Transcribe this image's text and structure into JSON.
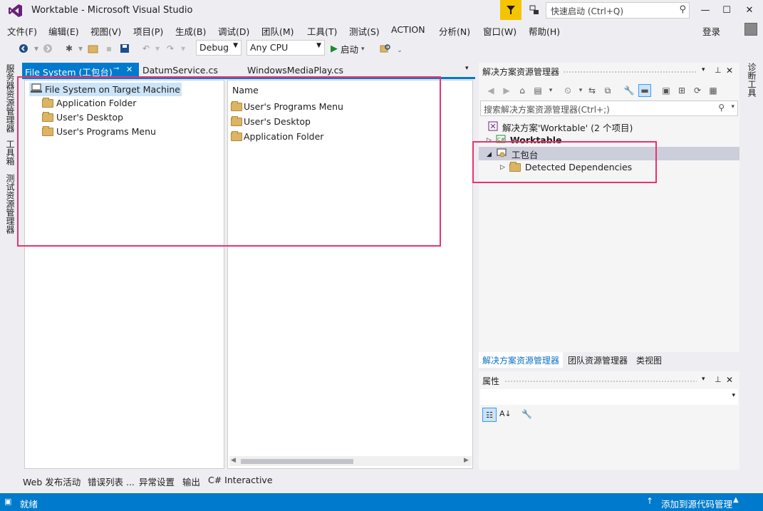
{
  "window": {
    "title": "Worktable - Microsoft Visual Studio"
  },
  "quick_launch": {
    "placeholder": "快速启动 (Ctrl+Q)"
  },
  "menu": [
    "文件(F)",
    "编辑(E)",
    "视图(V)",
    "项目(P)",
    "生成(B)",
    "调试(D)",
    "团队(M)",
    "工具(T)",
    "测试(S)",
    "ACTION",
    "分析(N)",
    "窗口(W)",
    "帮助(H)"
  ],
  "account": {
    "login": "登录"
  },
  "toolbar": {
    "config": "Debug",
    "platform": "Any CPU",
    "start": "启动"
  },
  "left_side_tabs": [
    "服务器资源管理器",
    "工具箱",
    "测试资源管理器"
  ],
  "right_side_tabs": [
    "诊断工具"
  ],
  "doc_tabs": [
    {
      "label": "File System (工包台)",
      "active": true,
      "pin": "⊸",
      "close": "✕"
    },
    {
      "label": "DatumService.cs"
    },
    {
      "label": "WindowsMediaPlay.cs"
    }
  ],
  "fs_tree": {
    "root": "File System on Target Machine",
    "children": [
      "Application Folder",
      "User's Desktop",
      "User's Programs Menu"
    ]
  },
  "fs_list": {
    "header": "Name",
    "items": [
      "User's Programs Menu",
      "User's Desktop",
      "Application Folder"
    ]
  },
  "solution_explorer": {
    "title": "解决方案资源管理器",
    "search_placeholder": "搜索解决方案资源管理器(Ctrl+;)",
    "solution": "解决方案'Worktable' (2 个项目)",
    "project1": "Worktable",
    "project2": "工包台",
    "child": "Detected Dependencies"
  },
  "bottom_tabs": [
    "解决方案资源管理器",
    "团队资源管理器",
    "类视图"
  ],
  "properties": {
    "title": "属性"
  },
  "output_tabs": [
    "Web 发布活动",
    "错误列表 ...",
    "异常设置",
    "输出",
    "C# Interactive"
  ],
  "status": {
    "left": "就绪",
    "right": "添加到源代码管理"
  },
  "colors": {
    "accent": "#007acc",
    "highlight": "#e8336d",
    "vs_purple": "#68217a"
  }
}
